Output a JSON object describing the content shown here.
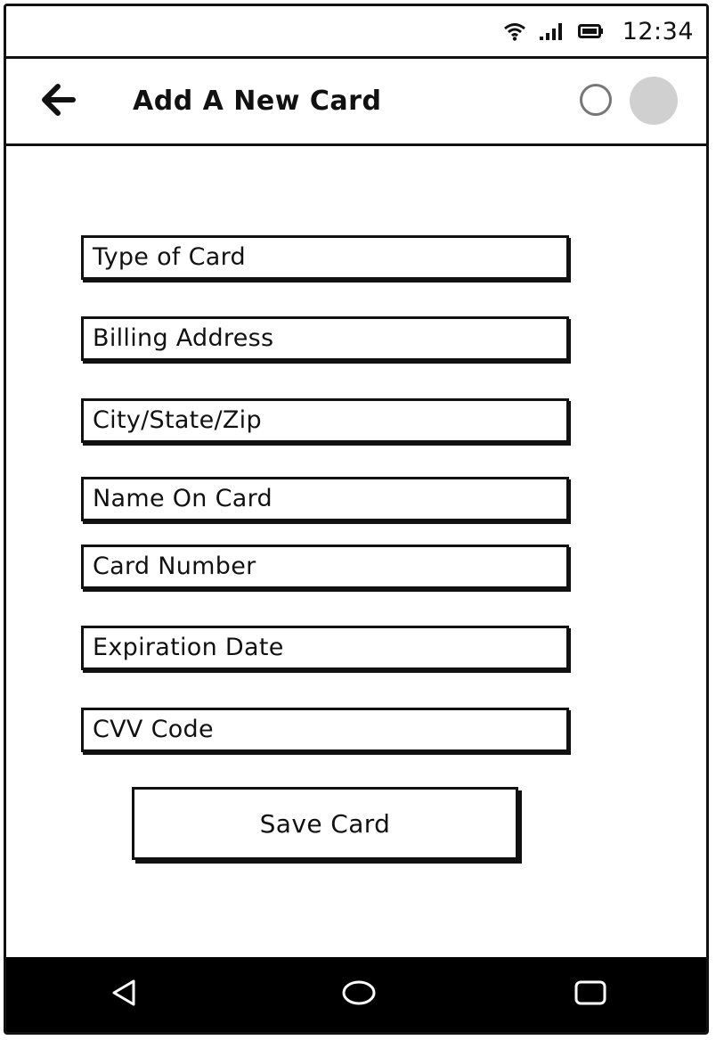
{
  "status_bar": {
    "time": "12:34",
    "icons": [
      "wifi-icon",
      "signal-icon",
      "battery-icon"
    ]
  },
  "app_bar": {
    "title": "Add A New Card",
    "back_icon": "arrow-left-icon"
  },
  "form": {
    "fields": [
      {
        "placeholder": "Type of Card"
      },
      {
        "placeholder": "Billing Address"
      },
      {
        "placeholder": "City/State/Zip"
      },
      {
        "placeholder": "Name On Card"
      },
      {
        "placeholder": "Card Number"
      },
      {
        "placeholder": "Expiration Date"
      },
      {
        "placeholder": "CVV Code"
      }
    ],
    "save_label": "Save Card"
  },
  "nav_bar": {
    "buttons": [
      "back-triangle-icon",
      "home-circle-icon",
      "recents-square-icon"
    ]
  },
  "colors": {
    "frame": "#111111",
    "nav_bg": "#000000",
    "circle_fill": "#d0d0d0",
    "circle_outline": "#777777"
  }
}
